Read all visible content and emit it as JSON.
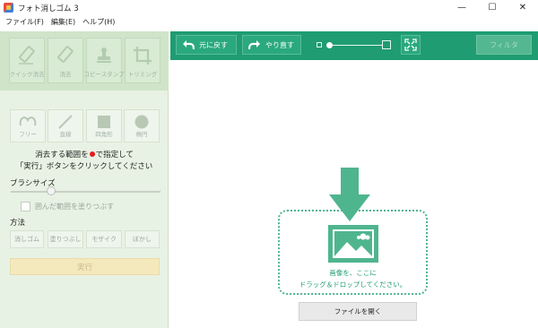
{
  "window": {
    "title": "フォト消しゴム 3",
    "minimize": "—",
    "maximize": "☐",
    "close": "✕"
  },
  "menu": [
    "ファイル(F)",
    "編集(E)",
    "ヘルプ(H)"
  ],
  "sidebar": {
    "tools": [
      "クイック消去",
      "消去",
      "コピースタンプ",
      "トリミング"
    ],
    "shapes": [
      "フリー",
      "直線",
      "四角形",
      "楕円"
    ],
    "instruction_line1_before": "消去する範囲を",
    "instruction_line1_after": "で指定して",
    "instruction_line2": "「実行」ボタンをクリックしてください",
    "brush_size_label": "ブラシサイズ",
    "brush_size_level": 0.27,
    "fill_enclosed_label": "囲んだ範囲を塗りつぶす",
    "fill_enclosed_checked": false,
    "method_label": "方法",
    "methods": [
      "消しゴム",
      "塗りつぶし",
      "モザイク",
      "ぼかし"
    ],
    "run_label": "実行"
  },
  "toolbar": {
    "undo_label": "元に戻す",
    "redo_label": "やり直す",
    "zoom_level": 0.0,
    "filter_label": "フィルタ"
  },
  "canvas": {
    "drop_line1": "画像を、ここに",
    "drop_line2": "ドラッグ＆ドロップしてください。",
    "open_file_label": "ファイルを開く"
  },
  "colors": {
    "accent": "#1f9c72",
    "sidebar_bg": "#e8f2e4",
    "run_button": "#f4e9bd",
    "red_dot": "#e31c1c"
  },
  "icons": [
    "app-icon",
    "undo-icon",
    "redo-icon",
    "fit-screen-icon",
    "down-arrow-icon",
    "image-icon"
  ]
}
